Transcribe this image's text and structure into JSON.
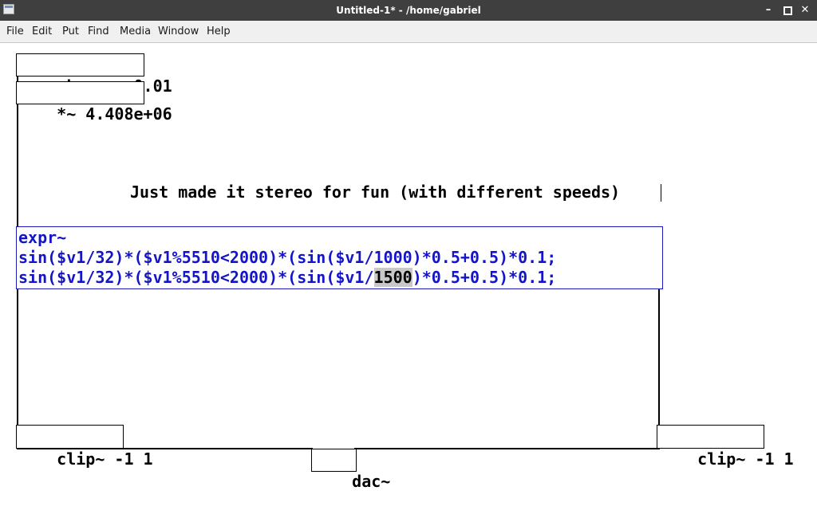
{
  "window": {
    "title": "Untitled-1* - /home/gabriel",
    "buttons": {
      "minimize": "–",
      "close": "✕"
    }
  },
  "menubar": {
    "items": [
      "File",
      "Edit",
      "Put",
      "Find",
      "Media",
      "Window",
      "Help"
    ]
  },
  "canvas": {
    "objects": {
      "phasor": "phasor~ 0.01",
      "multiply": "*~ 4.408e+06",
      "clip_left": "clip~ -1 1",
      "clip_right": "clip~ -1 1",
      "dac": "dac~"
    },
    "comment": "Just made it stereo for fun (with different speeds)",
    "expr": {
      "line1": "expr~",
      "line2": "sin($v1/32)*($v1%5510<2000)*(sin($v1/1000)*0.5+0.5)*0.1;",
      "line3_before": "sin($v1/32)*($v1%5510<2000)*(sin($v1/",
      "line3_selected": "1500",
      "line3_after": ")*0.5+0.5)*0.1;"
    }
  },
  "colors": {
    "titlebar": "#3f3f3f",
    "menubar": "#f0f0f0",
    "edit_text": "#1414c8",
    "edit_border": "#1a1ab8",
    "selection": "#c8c8c8"
  }
}
